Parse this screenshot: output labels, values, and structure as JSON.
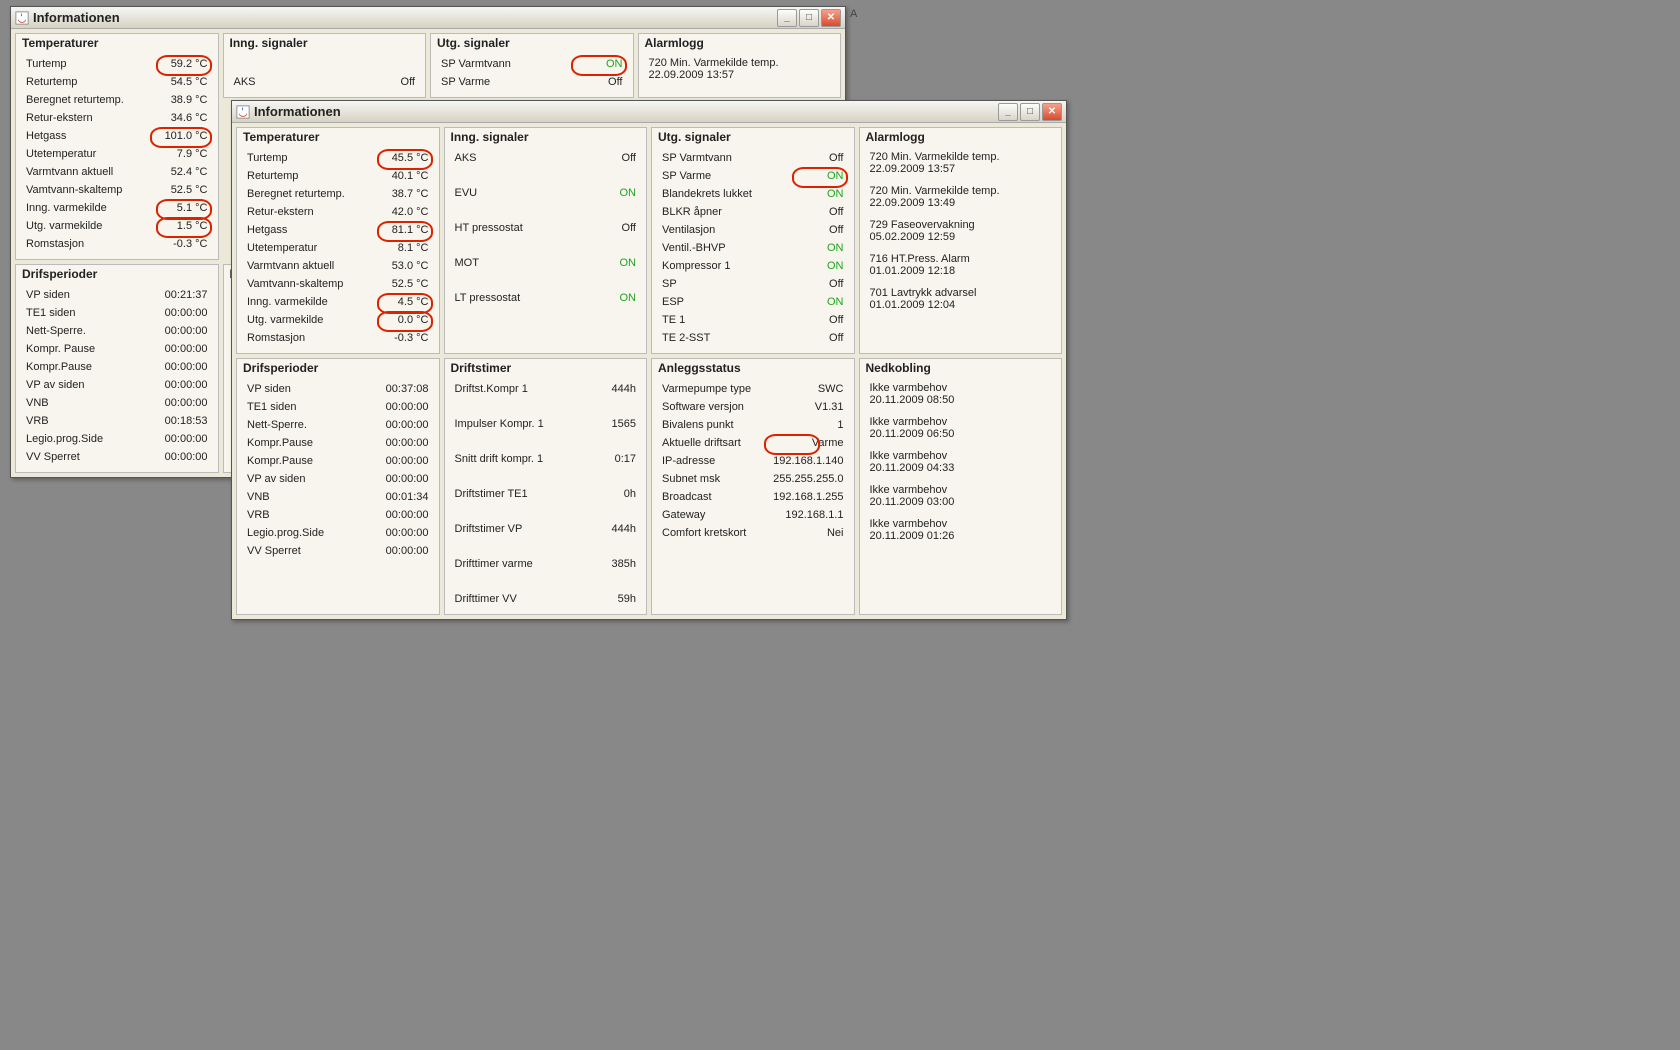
{
  "letter": "A",
  "win1": {
    "title": "Informationen",
    "temps_title": "Temperaturer",
    "temps": [
      {
        "l": "Turtemp",
        "v": "59.2 °C",
        "c": 1
      },
      {
        "l": "Returtemp",
        "v": "54.5 °C"
      },
      {
        "l": "Beregnet returtemp.",
        "v": "38.9 °C"
      },
      {
        "l": "Retur-ekstern",
        "v": "34.6 °C"
      },
      {
        "l": "Hetgass",
        "v": "101.0 °C",
        "c": 2
      },
      {
        "l": "Utetemperatur",
        "v": "7.9 °C"
      },
      {
        "l": "Varmtvann aktuell",
        "v": "52.4 °C"
      },
      {
        "l": "Vamtvann-skaltemp",
        "v": "52.5 °C"
      },
      {
        "l": "Inng. varmekilde",
        "v": "5.1 °C",
        "c": 1
      },
      {
        "l": "Utg. varmekilde",
        "v": "1.5 °C",
        "c": 1
      },
      {
        "l": "Romstasjon",
        "v": "-0.3 °C"
      }
    ],
    "drifs_title": "Drifsperioder",
    "drifs": [
      {
        "l": "VP siden",
        "v": "00:21:37"
      },
      {
        "l": "TE1 siden",
        "v": "00:00:00"
      },
      {
        "l": "Nett-Sperre.",
        "v": "00:00:00"
      },
      {
        "l": "Kompr. Pause",
        "v": "00:00:00"
      },
      {
        "l": "Kompr.Pause",
        "v": "00:00:00"
      },
      {
        "l": "VP av siden",
        "v": "00:00:00"
      },
      {
        "l": "VNB",
        "v": "00:00:00"
      },
      {
        "l": "VRB",
        "v": "00:18:53"
      },
      {
        "l": "Legio.prog.Side",
        "v": "00:00:00"
      },
      {
        "l": "VV Sperret",
        "v": "00:00:00"
      }
    ],
    "inng_title": "Inng. signaler",
    "inng": [
      {
        "l": "AKS",
        "v": "Off"
      }
    ],
    "utg_title": "Utg. signaler",
    "utg": [
      {
        "l": "SP Varmtvann",
        "v": "ON",
        "on": 1,
        "c": 1
      },
      {
        "l": "SP Varme",
        "v": "Off"
      }
    ],
    "alarm_title": "Alarmlogg",
    "alarm": [
      {
        "t": "720 Min. Varmekilde temp.",
        "d": "22.09.2009 13:57"
      }
    ],
    "truncD": "D"
  },
  "win2": {
    "title": "Informationen",
    "temps_title": "Temperaturer",
    "temps": [
      {
        "l": "Turtemp",
        "v": "45.5 °C",
        "c": 1
      },
      {
        "l": "Returtemp",
        "v": "40.1 °C"
      },
      {
        "l": "Beregnet returtemp.",
        "v": "38.7 °C"
      },
      {
        "l": "Retur-ekstern",
        "v": "42.0 °C"
      },
      {
        "l": "Hetgass",
        "v": "81.1 °C",
        "c": 1
      },
      {
        "l": "Utetemperatur",
        "v": "8.1 °C"
      },
      {
        "l": "Varmtvann aktuell",
        "v": "53.0 °C"
      },
      {
        "l": "Vamtvann-skaltemp",
        "v": "52.5 °C"
      },
      {
        "l": "Inng. varmekilde",
        "v": "4.5 °C",
        "c": 1
      },
      {
        "l": "Utg. varmekilde",
        "v": "0.0 °C",
        "c": 1
      },
      {
        "l": "Romstasjon",
        "v": "-0.3 °C"
      }
    ],
    "drifs_title": "Drifsperioder",
    "drifs": [
      {
        "l": "VP siden",
        "v": "00:37:08"
      },
      {
        "l": "TE1 siden",
        "v": "00:00:00"
      },
      {
        "l": "Nett-Sperre.",
        "v": "00:00:00"
      },
      {
        "l": "Kompr.Pause",
        "v": "00:00:00"
      },
      {
        "l": "Kompr.Pause",
        "v": "00:00:00"
      },
      {
        "l": "VP av siden",
        "v": "00:00:00"
      },
      {
        "l": "VNB",
        "v": "00:01:34"
      },
      {
        "l": "VRB",
        "v": "00:00:00"
      },
      {
        "l": "Legio.prog.Side",
        "v": "00:00:00"
      },
      {
        "l": "VV Sperret",
        "v": "00:00:00"
      }
    ],
    "inng_title": "Inng. signaler",
    "inng": [
      {
        "l": "AKS",
        "v": "Off",
        "sp": 1
      },
      {
        "l": "EVU",
        "v": "ON",
        "on": 1,
        "sp": 1
      },
      {
        "l": "HT pressostat",
        "v": "Off",
        "sp": 1
      },
      {
        "l": "MOT",
        "v": "ON",
        "on": 1,
        "sp": 1
      },
      {
        "l": "LT pressostat",
        "v": "ON",
        "on": 1
      }
    ],
    "driftst_title": "Driftstimer",
    "driftst": [
      {
        "l": "Driftst.Kompr 1",
        "v": "444h",
        "sp": 1
      },
      {
        "l": "Impulser Kompr. 1",
        "v": "1565",
        "sp": 1
      },
      {
        "l": "Snitt drift kompr. 1",
        "v": "0:17",
        "sp": 1
      },
      {
        "l": "Driftstimer TE1",
        "v": "0h",
        "sp": 1
      },
      {
        "l": "Driftstimer VP",
        "v": "444h",
        "sp": 1
      },
      {
        "l": "Drifttimer varme",
        "v": "385h",
        "sp": 1
      },
      {
        "l": "Drifttimer VV",
        "v": "59h"
      }
    ],
    "utg_title": "Utg. signaler",
    "utg": [
      {
        "l": "SP Varmtvann",
        "v": "Off"
      },
      {
        "l": "SP Varme",
        "v": "ON",
        "on": 1,
        "c": 1
      },
      {
        "l": "Blandekrets lukket",
        "v": "ON",
        "on": 1
      },
      {
        "l": "BLKR åpner",
        "v": "Off"
      },
      {
        "l": "Ventilasjon",
        "v": "Off"
      },
      {
        "l": "Ventil.-BHVP",
        "v": "ON",
        "on": 1
      },
      {
        "l": "Kompressor 1",
        "v": "ON",
        "on": 1
      },
      {
        "l": "SP",
        "v": "Off"
      },
      {
        "l": "ESP",
        "v": "ON",
        "on": 1
      },
      {
        "l": "TE 1",
        "v": "Off"
      },
      {
        "l": "TE 2-SST",
        "v": "Off"
      }
    ],
    "anl_title": "Anleggsstatus",
    "anl": [
      {
        "l": "Varmepumpe type",
        "v": "SWC"
      },
      {
        "l": "Software versjon",
        "v": "V1.31"
      },
      {
        "l": "Bivalens punkt",
        "v": "1"
      },
      {
        "l": "Aktuelle driftsart",
        "v": "Varme",
        "cmv": 1
      },
      {
        "l": "IP-adresse",
        "v": "192.168.1.140"
      },
      {
        "l": "Subnet msk",
        "v": "255.255.255.0"
      },
      {
        "l": "Broadcast",
        "v": "192.168.1.255"
      },
      {
        "l": "Gateway",
        "v": "192.168.1.1"
      },
      {
        "l": "Comfort kretskort",
        "v": "Nei"
      }
    ],
    "alarm_title": "Alarmlogg",
    "alarm": [
      {
        "t": "720 Min. Varmekilde temp.",
        "d": "22.09.2009 13:57"
      },
      {
        "t": "720 Min. Varmekilde temp.",
        "d": "22.09.2009 13:49"
      },
      {
        "t": "729 Faseovervakning",
        "d": "05.02.2009 12:59"
      },
      {
        "t": "716 HT.Press. Alarm",
        "d": "01.01.2009 12:18"
      },
      {
        "t": "701 Lavtrykk advarsel",
        "d": "01.01.2009 12:04"
      }
    ],
    "ned_title": "Nedkobling",
    "ned": [
      {
        "t": "Ikke varmbehov",
        "d": "20.11.2009 08:50"
      },
      {
        "t": "Ikke varmbehov",
        "d": "20.11.2009 06:50"
      },
      {
        "t": "Ikke varmbehov",
        "d": "20.11.2009 04:33"
      },
      {
        "t": "Ikke varmbehov",
        "d": "20.11.2009 03:00"
      },
      {
        "t": "Ikke varmbehov",
        "d": "20.11.2009 01:26"
      }
    ]
  }
}
